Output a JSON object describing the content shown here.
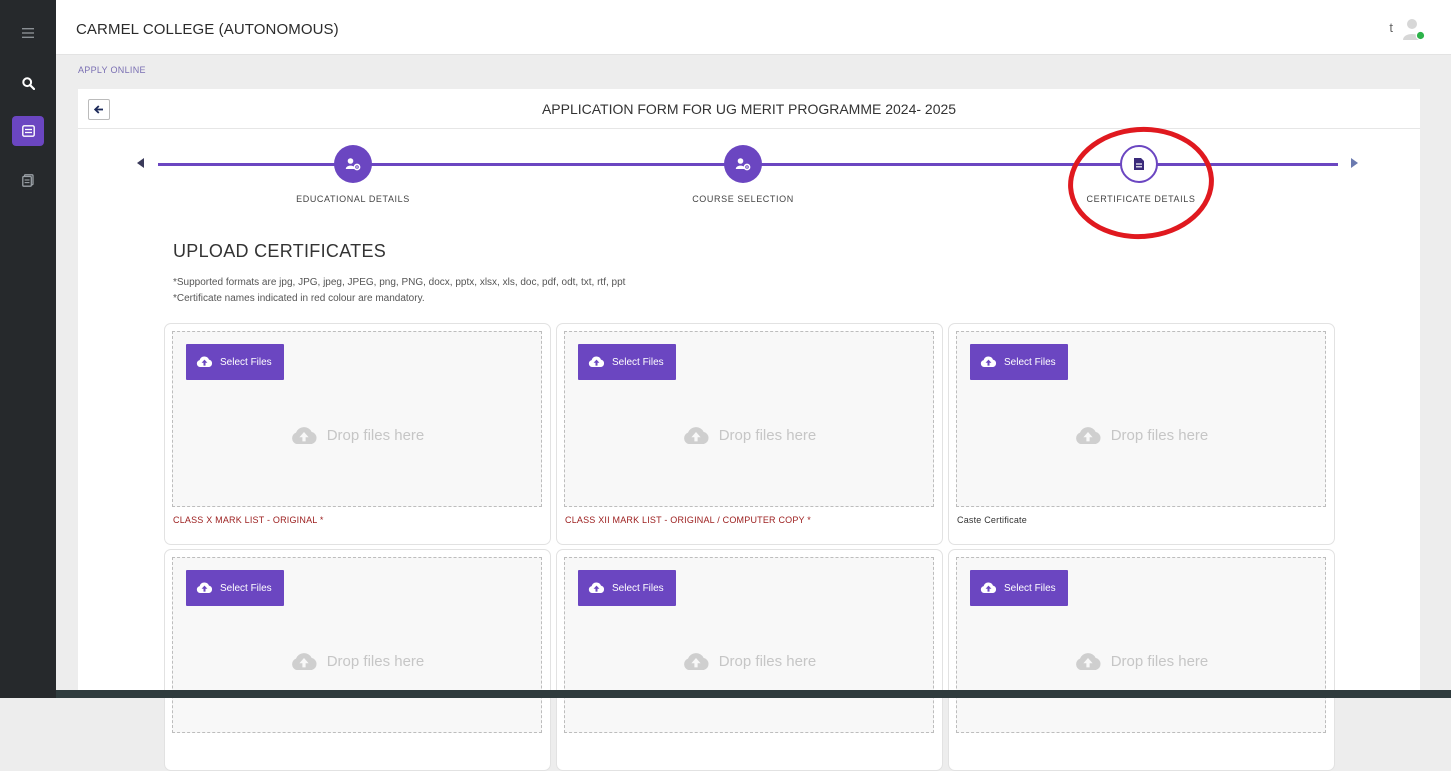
{
  "sidebar": {
    "items": [
      {
        "icon": "menu-icon"
      },
      {
        "icon": "search-icon"
      },
      {
        "icon": "form-icon",
        "active": true
      },
      {
        "icon": "document-icon"
      }
    ]
  },
  "header": {
    "college_name": "CARMEL COLLEGE (AUTONOMOUS)",
    "user_initial": "t",
    "user_status_color": "#2db34a"
  },
  "breadcrumb": "APPLY ONLINE",
  "form": {
    "title": "APPLICATION FORM FOR UG MERIT PROGRAMME 2024- 2025"
  },
  "stepper": {
    "accent_color": "#6b46c1",
    "steps": [
      {
        "label": "EDUCATIONAL DETAILS",
        "icon": "user-settings-icon"
      },
      {
        "label": "COURSE SELECTION",
        "icon": "user-settings-icon"
      },
      {
        "label": "CERTIFICATE DETAILS",
        "icon": "document-icon",
        "current": true
      }
    ],
    "highlight_color": "#e0191f"
  },
  "upload": {
    "section_title": "UPLOAD CERTIFICATES",
    "notes": [
      "*Supported formats are jpg, JPG, jpeg, JPEG, png, PNG, docx, pptx, xlsx, xls, doc, pdf, odt, txt, rtf, ppt",
      "*Certificate names indicated in red colour are mandatory."
    ],
    "select_label": "Select Files",
    "drop_label": "Drop files here",
    "certificates": [
      {
        "name": "CLASS X MARK LIST - ORIGINAL *",
        "mandatory": true
      },
      {
        "name": "CLASS XII MARK LIST - ORIGINAL / COMPUTER COPY *",
        "mandatory": true
      },
      {
        "name": "Caste Certificate",
        "mandatory": false
      },
      {
        "name": "",
        "mandatory": false
      },
      {
        "name": "",
        "mandatory": false
      },
      {
        "name": "",
        "mandatory": false
      }
    ]
  }
}
